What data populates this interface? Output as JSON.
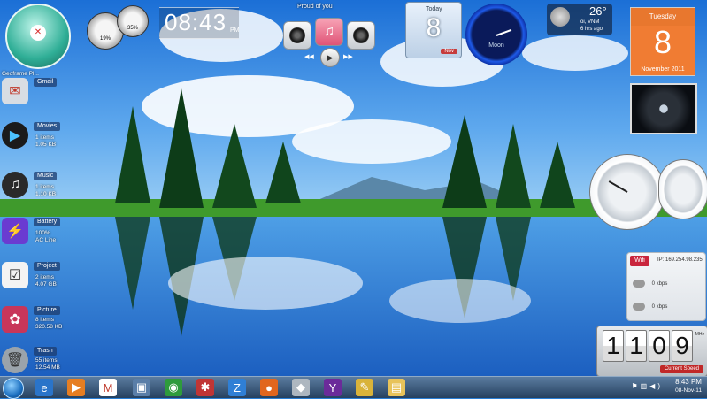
{
  "dock": {
    "top_label": "Geoframe Pl...",
    "items": [
      {
        "label": "Gmail",
        "stat1": "",
        "stat2": "",
        "icon": "mail-icon",
        "color": "#d8dde3"
      },
      {
        "label": "Movies",
        "stat1": "1 items",
        "stat2": "1.05 KB",
        "icon": "play-icon",
        "color": "#1b1b1b"
      },
      {
        "label": "Music",
        "stat1": "1 items",
        "stat2": "1.10 KB",
        "icon": "music-icon",
        "color": "#2a2a2a"
      },
      {
        "label": "Battery",
        "stat1": "100%",
        "stat2": "AC Line",
        "icon": "bolt-icon",
        "color": "#6a3bd1"
      },
      {
        "label": "Project",
        "stat1": "2 items",
        "stat2": "4.07 GB",
        "icon": "checkbox-icon",
        "color": "#f3f3f3"
      },
      {
        "label": "Picture",
        "stat1": "8 items",
        "stat2": "320.58 KB",
        "icon": "flower-icon",
        "color": "#c8365a"
      },
      {
        "label": "Trash",
        "stat1": "55 items",
        "stat2": "12.54 MB",
        "icon": "trash-icon",
        "color": "#9aa3ab"
      }
    ]
  },
  "clock": {
    "time": "08:43",
    "ampm": "PM"
  },
  "media": {
    "title": "Proud of you"
  },
  "date_tile": {
    "day": "8",
    "label": "Today",
    "button": "Nov"
  },
  "moon_clock": {
    "label": "Moon"
  },
  "weather": {
    "temp": "26°",
    "location": "oi, VNM",
    "age": "6 hrs ago"
  },
  "calendar": {
    "weekday": "Tuesday",
    "day": "8",
    "month": "November 2011"
  },
  "network": {
    "logo": "Wifi",
    "ip": "IP: 169.254.98.235",
    "up": "0 kbps",
    "down": "0 kbps"
  },
  "speed_counter": {
    "digits": [
      "1",
      "1",
      "0",
      "9"
    ],
    "unit": "MHz",
    "caption": "Current Speed"
  },
  "gauges": {
    "cpu": "19%",
    "ram": "35%"
  },
  "taskbar": {
    "time": "8:43 PM",
    "date": "08-Nov-11",
    "pinned": [
      {
        "name": "ie-icon",
        "glyph": "e",
        "color": "#2a74c9"
      },
      {
        "name": "media-player-icon",
        "glyph": "▶",
        "color": "#e67e22"
      },
      {
        "name": "mifi-icon",
        "glyph": "M",
        "color": "#fff"
      },
      {
        "name": "monitor-icon",
        "glyph": "▣",
        "color": "#5a7ea8"
      },
      {
        "name": "globe-icon",
        "glyph": "◉",
        "color": "#2e9b3c"
      },
      {
        "name": "spider-icon",
        "glyph": "✱",
        "color": "#c03535"
      },
      {
        "name": "z-icon",
        "glyph": "Z",
        "color": "#2f7fd5"
      },
      {
        "name": "firefox-icon",
        "glyph": "●",
        "color": "#e1661e"
      },
      {
        "name": "app-icon",
        "glyph": "◆",
        "color": "#aeb7c0"
      },
      {
        "name": "yahoo-icon",
        "glyph": "Y",
        "color": "#6b2b9a"
      },
      {
        "name": "paint-icon",
        "glyph": "✎",
        "color": "#d9b33a"
      },
      {
        "name": "explorer-icon",
        "glyph": "▤",
        "color": "#e8c35a"
      }
    ]
  }
}
